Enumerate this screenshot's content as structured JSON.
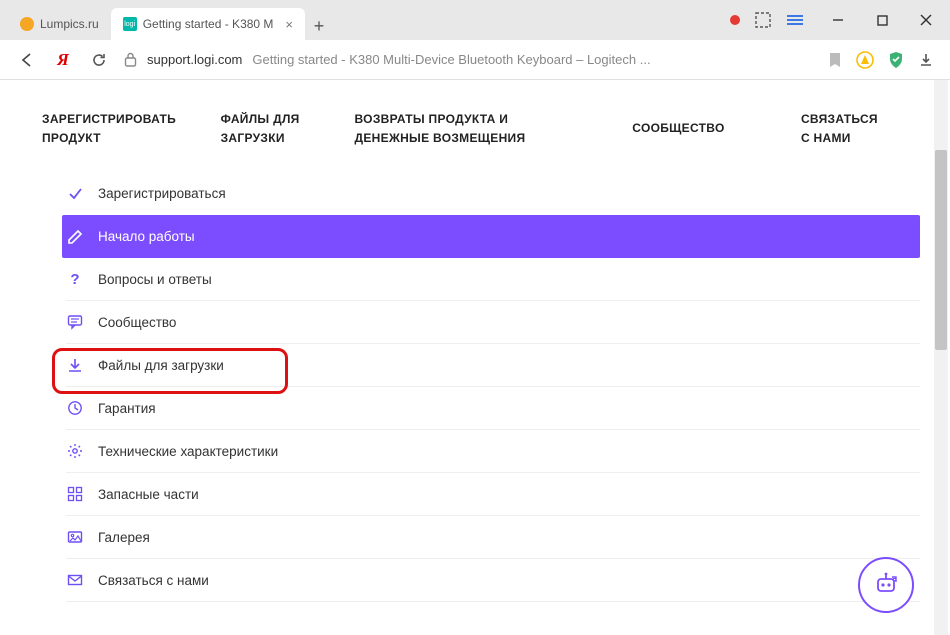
{
  "tabs": [
    {
      "label": "Lumpics.ru",
      "favicon_color": "#f5a623",
      "active": false,
      "closable": false
    },
    {
      "label": "Getting started - K380 M",
      "favicon_label": "logi",
      "active": true,
      "closable": true
    }
  ],
  "state_dot_color": "#e53935",
  "address": {
    "domain": "support.logi.com",
    "title": "Getting started - K380 Multi-Device Bluetooth Keyboard – Logitech ..."
  },
  "topnav": {
    "c1a": "ЗАРЕГИСТРИРОВАТЬ",
    "c1b": "ПРОДУКТ",
    "c2a": "ФАЙЛЫ ДЛЯ",
    "c2b": "ЗАГРУЗКИ",
    "c3a": "ВОЗВРАТЫ ПРОДУКТА И",
    "c3b": "ДЕНЕЖНЫЕ ВОЗМЕЩЕНИЯ",
    "c4": "СООБЩЕСТВО",
    "c5a": "СВЯЗАТЬСЯ",
    "c5b": "С НАМИ"
  },
  "items": [
    {
      "icon": "check",
      "label": "Зарегистрироваться"
    },
    {
      "icon": "pencil",
      "label": "Начало работы",
      "active": true
    },
    {
      "icon": "question",
      "label": "Вопросы и ответы"
    },
    {
      "icon": "chat",
      "label": "Сообщество"
    },
    {
      "icon": "download",
      "label": "Файлы для загрузки",
      "highlighted": true
    },
    {
      "icon": "clock",
      "label": "Гарантия"
    },
    {
      "icon": "gear",
      "label": "Технические характеристики"
    },
    {
      "icon": "grid",
      "label": "Запасные части"
    },
    {
      "icon": "gallery",
      "label": "Галерея"
    },
    {
      "icon": "mail",
      "label": "Связаться с нами"
    }
  ]
}
